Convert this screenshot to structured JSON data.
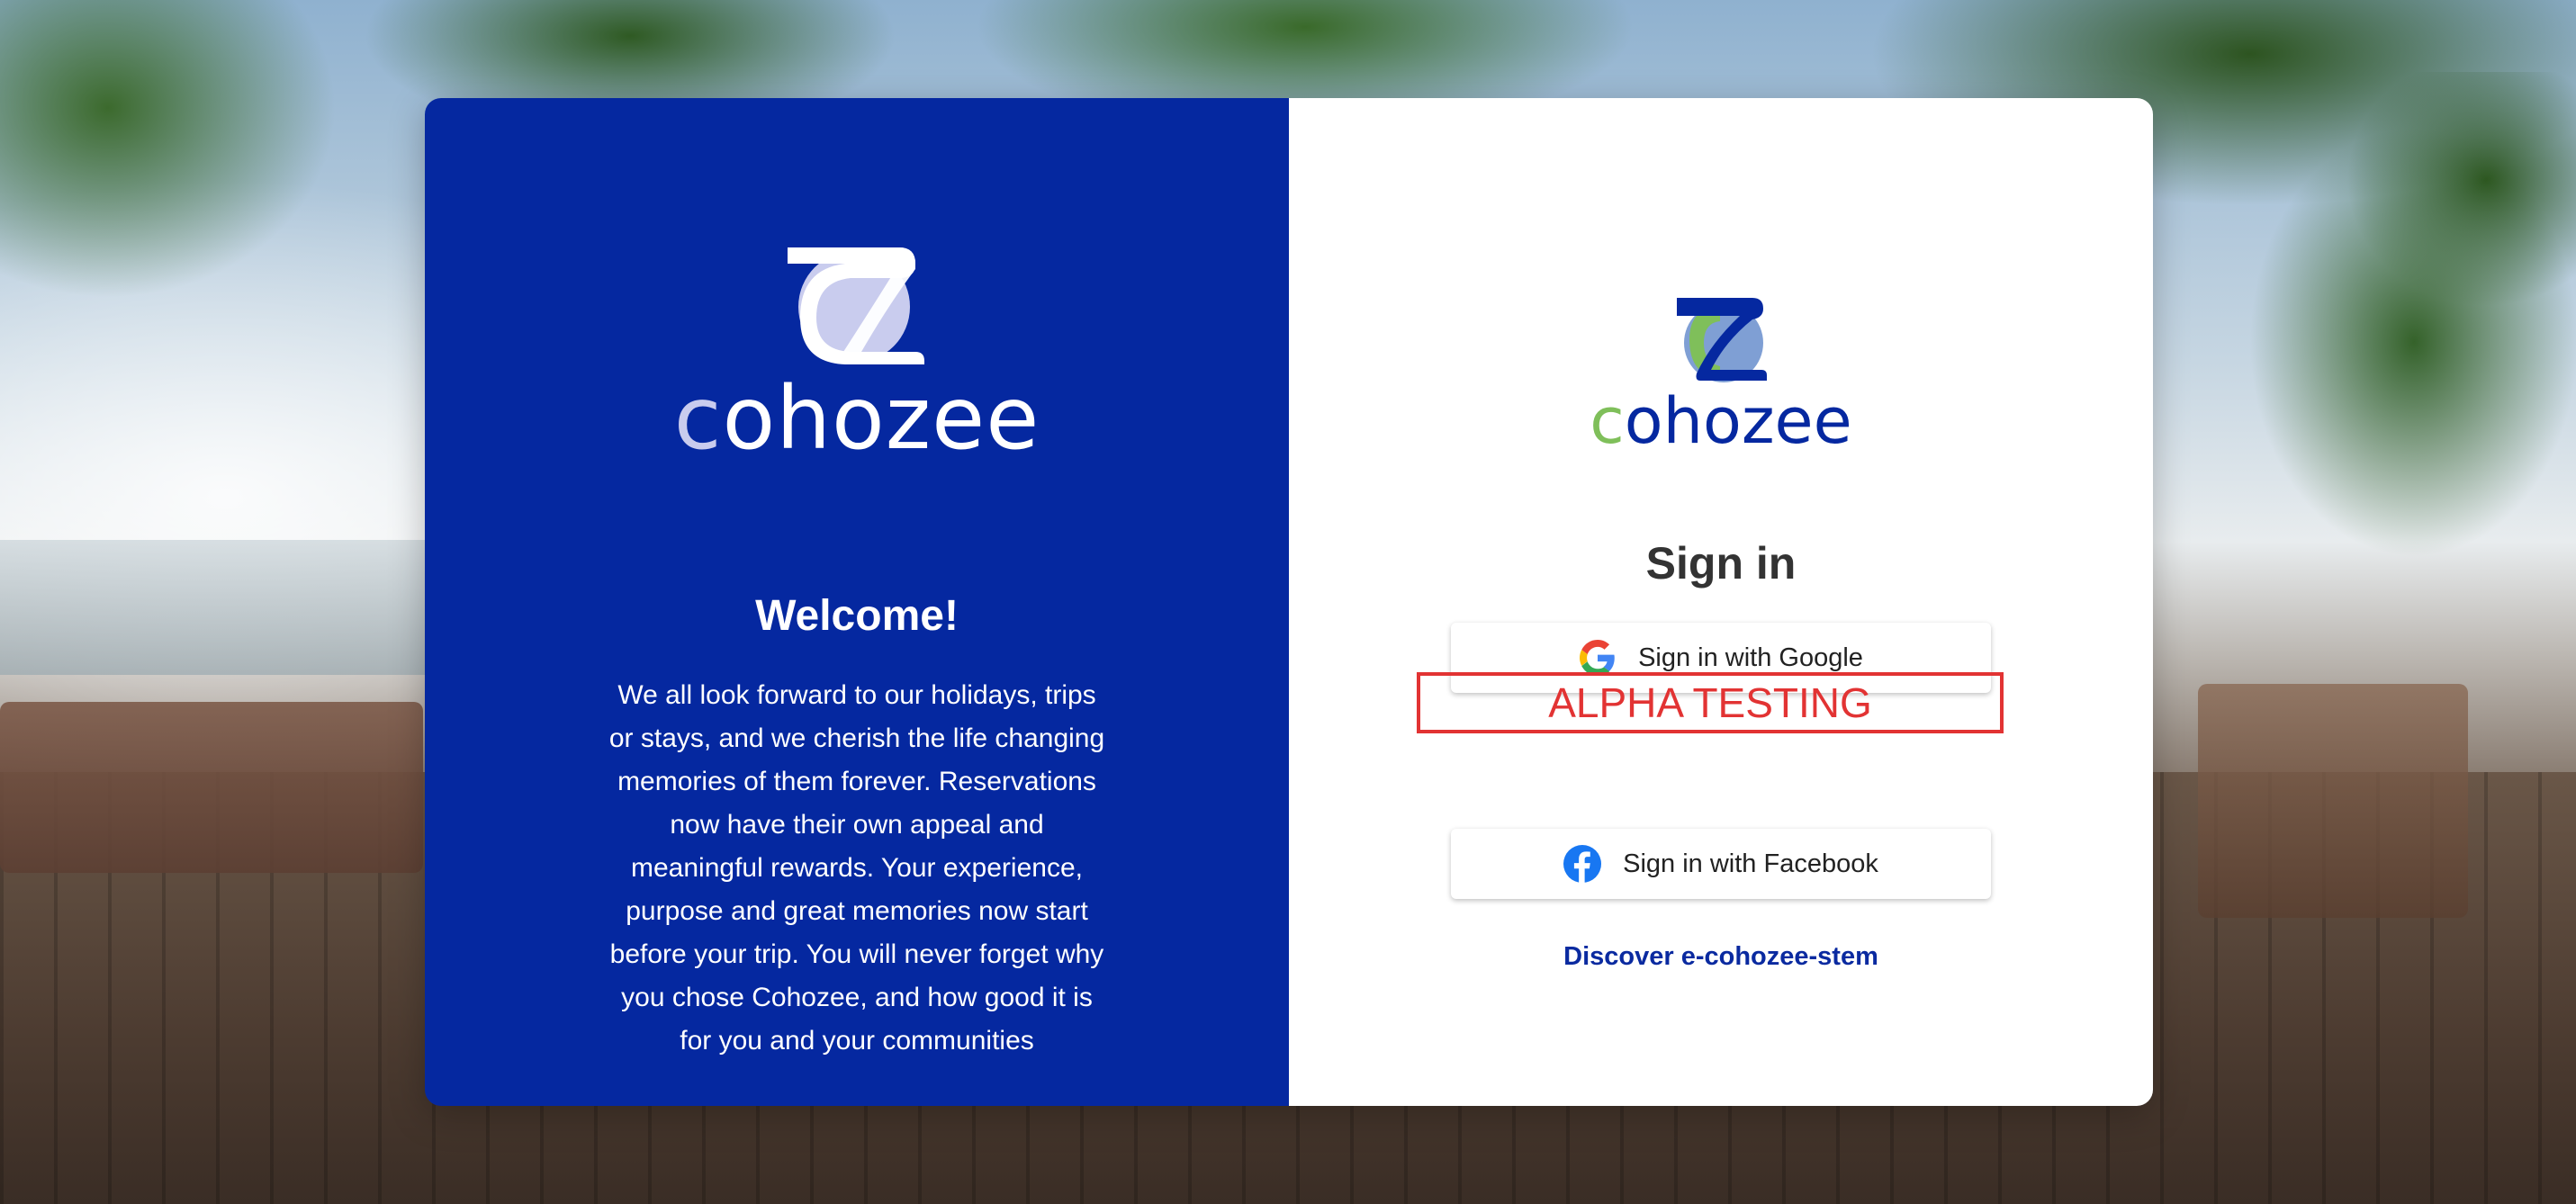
{
  "brand": {
    "name": "cohozee",
    "name_first_letter": "c",
    "name_rest": "ohozee",
    "primary_color": "#0528a0",
    "accent_green": "#7fbf5a"
  },
  "left_panel": {
    "welcome_title": "Welcome!",
    "intro_text": "We all look forward to our holidays, trips or stays, and we cherish the life changing memories of them forever. Reservations now have their own appeal and meaningful rewards. Your experience, purpose and great memories now start before your trip. You will never forget why you chose Cohozee, and how good it is for you and your communities"
  },
  "right_panel": {
    "signin_title": "Sign in",
    "google_button_label": "Sign in with Google",
    "facebook_button_label": "Sign in with Facebook",
    "alpha_banner": "ALPHA TESTING",
    "discover_link": "Discover e-cohozee-stem",
    "icons": {
      "google": "google-icon",
      "facebook": "facebook-icon"
    },
    "alpha_color": "#e23333"
  }
}
